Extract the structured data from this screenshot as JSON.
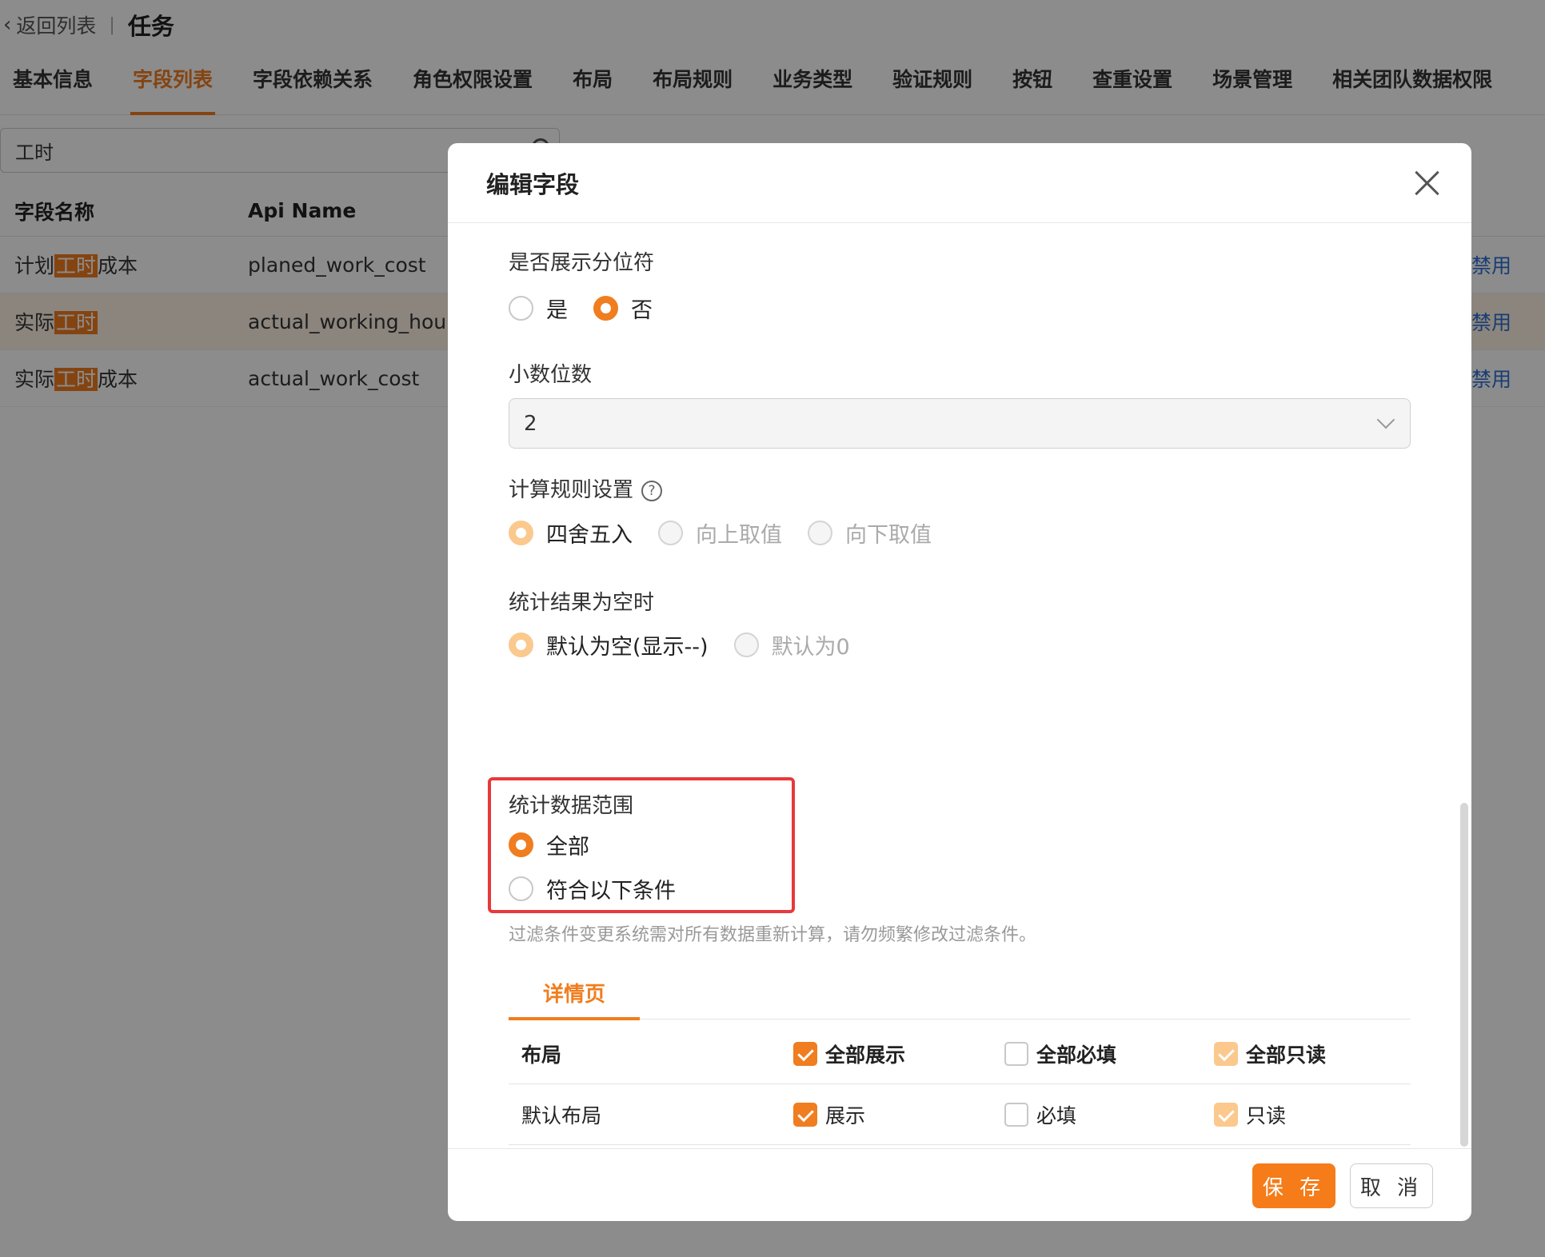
{
  "header": {
    "back_label": "返回列表",
    "separator": "|",
    "title": "任务"
  },
  "tabs": [
    "基本信息",
    "字段列表",
    "字段依赖关系",
    "角色权限设置",
    "布局",
    "布局规则",
    "业务类型",
    "验证规则",
    "按钮",
    "查重设置",
    "场景管理",
    "相关团队数据权限"
  ],
  "active_tab": "字段列表",
  "search": {
    "value": "工时"
  },
  "table": {
    "columns": [
      "字段名称",
      "Api Name"
    ],
    "rows": [
      {
        "name_pre": "计划",
        "name_hl": "工时",
        "name_post": "成本",
        "api": "planed_work_cost",
        "action": "禁用"
      },
      {
        "name_pre": "实际",
        "name_hl": "工时",
        "name_post": "",
        "api": "actual_working_hours",
        "action": "禁用"
      },
      {
        "name_pre": "实际",
        "name_hl": "工时",
        "name_post": "成本",
        "api": "actual_work_cost",
        "action": "禁用"
      }
    ]
  },
  "modal": {
    "title": "编辑字段",
    "separator_field": {
      "label": "是否展示分位符",
      "options": [
        "是",
        "否"
      ],
      "selected": "否"
    },
    "decimal_field": {
      "label": "小数位数",
      "value": "2"
    },
    "rounding_field": {
      "label": "计算规则设置",
      "help": "?",
      "options": [
        "四舍五入",
        "向上取值",
        "向下取值"
      ],
      "selected": "四舍五入"
    },
    "empty_field": {
      "label": "统计结果为空时",
      "options": [
        "默认为空(显示--)",
        "默认为0"
      ],
      "selected": "默认为空(显示--)"
    },
    "range_field": {
      "label": "统计数据范围",
      "options": [
        "全部",
        "符合以下条件"
      ],
      "selected": "全部"
    },
    "hint": "过滤条件变更系统需对所有数据重新计算，请勿频繁修改过滤条件。",
    "detail_tab": "详情页",
    "layout_table": {
      "head": {
        "name": "布局",
        "show": "全部展示",
        "required": "全部必填",
        "readonly": "全部只读"
      },
      "rows": [
        {
          "name": "默认布局",
          "show": "展示",
          "required": "必填",
          "readonly": "只读"
        }
      ]
    },
    "buttons": {
      "save": "保 存",
      "cancel": "取 消"
    }
  },
  "colors": {
    "accent": "#f07d1f",
    "link": "#2f6fd6",
    "highlight_box": "#e8393b"
  }
}
